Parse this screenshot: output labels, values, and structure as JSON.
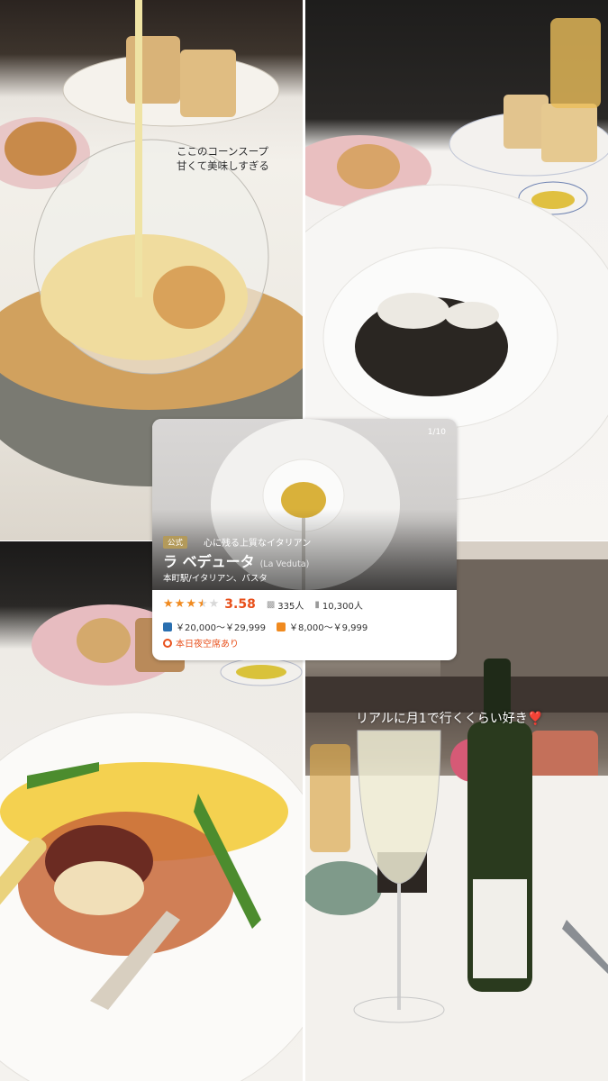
{
  "captions": {
    "corn_soup_line1": "ここのコーンスープ",
    "corn_soup_line2": "甘くて美味しすぎる",
    "wine": "リアルに月1で行くくらい好き❣️"
  },
  "restaurant_card": {
    "pager": "1/10",
    "badge": "公式",
    "tagline": "心に残る上質なイタリアン",
    "name": "ラ ベデュータ",
    "name_en": "(La Veduta)",
    "meta": "本町駅/イタリアン、パスタ",
    "rating": {
      "stars_value": 3.58,
      "score_label": "3.58"
    },
    "reviews": "335人",
    "saves": "10,300人",
    "dinner_price": "￥20,000～￥29,999",
    "lunch_price": "￥8,000～￥9,999",
    "availability": "本日夜空席あり",
    "colors": {
      "accent": "#e8501b",
      "star": "#f08a1f",
      "badge": "#b39a5b"
    }
  },
  "icons": {
    "review": "speech-bubble-icon",
    "save": "bookmark-icon",
    "dinner": "moon-icon",
    "lunch": "sun-icon",
    "availability": "circle-icon"
  }
}
